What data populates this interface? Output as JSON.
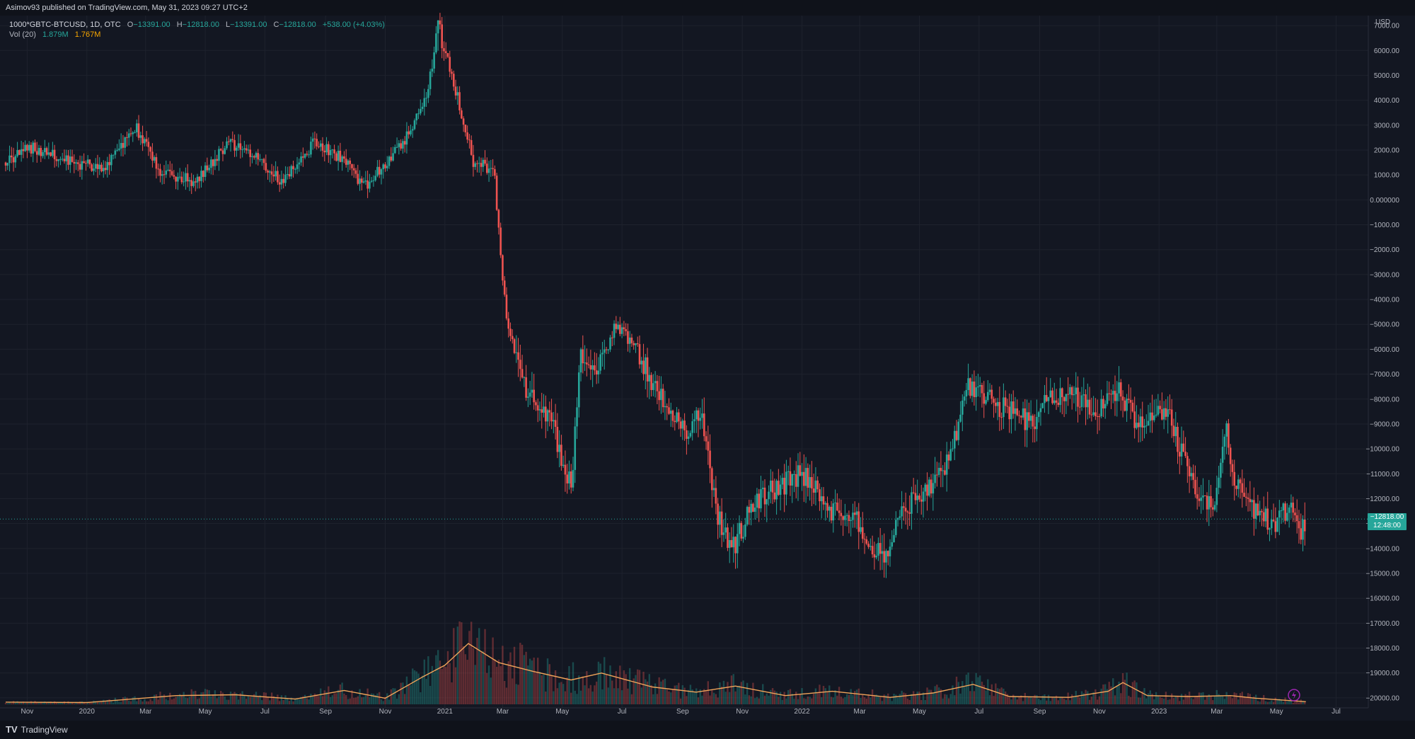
{
  "header": {
    "publisher_text": "Asimov93 published on TradingView.com, May 31, 2023 09:27 UTC+2"
  },
  "legend": {
    "symbol": "1000*GBTC-BTCUSD, 1D, OTC",
    "open_label": "O",
    "open_value": "−13391.00",
    "high_label": "H",
    "high_value": "−12818.00",
    "low_label": "L",
    "low_value": "−13391.00",
    "close_label": "C",
    "close_value": "−12818.00",
    "change_value": "+538.00 (+4.03%)",
    "vol_label": "Vol (20)",
    "vol_value": "1.879M",
    "vol_ma_value": "1.767M"
  },
  "axis": {
    "currency": "USD"
  },
  "price_tag": {
    "value": "−12818.00",
    "countdown": "12:48:00"
  },
  "brand": {
    "name": "TradingView",
    "logo_text": "TV"
  },
  "colors": {
    "background": "#131722",
    "up": "#26a69a",
    "down": "#ef5350",
    "vol_ma": "#f0a45a",
    "grid": "#1e222d",
    "axis_text": "#b2b5be"
  },
  "chart_data": {
    "type": "candlestick",
    "y_axis": {
      "unit": "USD",
      "range": [
        -20400,
        7400
      ],
      "ticks": [
        7000,
        6000,
        5000,
        4000,
        3000,
        2000,
        1000,
        0,
        -1000,
        -2000,
        -3000,
        -4000,
        -5000,
        -6000,
        -7000,
        -8000,
        -9000,
        -10000,
        -11000,
        -12000,
        -13000,
        -14000,
        -15000,
        -16000,
        -17000,
        -18000,
        -19000,
        -20000
      ],
      "tick_labels": [
        "7000.00",
        "6000.00",
        "5000.00",
        "4000.00",
        "3000.00",
        "2000.00",
        "1000.00",
        "0.000000",
        "−1000.00",
        "−2000.00",
        "−3000.00",
        "−4000.00",
        "−5000.00",
        "−6000.00",
        "−7000.00",
        "−8000.00",
        "−9000.00",
        "−10000.00",
        "−11000.00",
        "−12000.00",
        "−13000.00",
        "−14000.00",
        "−15000.00",
        "−16000.00",
        "−17000.00",
        "−18000.00",
        "−19000.00",
        "−20000.00"
      ]
    },
    "x_axis": {
      "range": [
        "2019-10-10",
        "2023-07-31"
      ],
      "ticks": [
        {
          "label": "Nov",
          "date": "2019-11-01"
        },
        {
          "label": "2020",
          "date": "2020-01-01"
        },
        {
          "label": "Mar",
          "date": "2020-03-01"
        },
        {
          "label": "May",
          "date": "2020-05-01"
        },
        {
          "label": "Jul",
          "date": "2020-07-01"
        },
        {
          "label": "Sep",
          "date": "2020-09-01"
        },
        {
          "label": "Nov",
          "date": "2020-11-01"
        },
        {
          "label": "2021",
          "date": "2021-01-01"
        },
        {
          "label": "Mar",
          "date": "2021-03-01"
        },
        {
          "label": "May",
          "date": "2021-05-01"
        },
        {
          "label": "Jul",
          "date": "2021-07-01"
        },
        {
          "label": "Sep",
          "date": "2021-09-01"
        },
        {
          "label": "Nov",
          "date": "2021-11-01"
        },
        {
          "label": "2022",
          "date": "2022-01-01"
        },
        {
          "label": "Mar",
          "date": "2022-03-01"
        },
        {
          "label": "May",
          "date": "2022-05-01"
        },
        {
          "label": "Jul",
          "date": "2022-07-01"
        },
        {
          "label": "Sep",
          "date": "2022-09-01"
        },
        {
          "label": "Nov",
          "date": "2022-11-01"
        },
        {
          "label": "2023",
          "date": "2023-01-01"
        },
        {
          "label": "Mar",
          "date": "2023-03-01"
        },
        {
          "label": "May",
          "date": "2023-05-01"
        },
        {
          "label": "Jul",
          "date": "2023-07-01"
        }
      ]
    },
    "price_path": [
      {
        "date": "2019-10-10",
        "value": 1500
      },
      {
        "date": "2019-11-05",
        "value": 2100
      },
      {
        "date": "2019-12-15",
        "value": 1500
      },
      {
        "date": "2020-01-20",
        "value": 1300
      },
      {
        "date": "2020-02-20",
        "value": 2900
      },
      {
        "date": "2020-03-15",
        "value": 1200
      },
      {
        "date": "2020-04-20",
        "value": 700
      },
      {
        "date": "2020-05-25",
        "value": 2300
      },
      {
        "date": "2020-06-20",
        "value": 1700
      },
      {
        "date": "2020-07-20",
        "value": 700
      },
      {
        "date": "2020-08-20",
        "value": 2300
      },
      {
        "date": "2020-09-20",
        "value": 1600
      },
      {
        "date": "2020-10-10",
        "value": 500
      },
      {
        "date": "2020-11-05",
        "value": 1700
      },
      {
        "date": "2020-11-25",
        "value": 2600
      },
      {
        "date": "2020-12-15",
        "value": 4500
      },
      {
        "date": "2020-12-25",
        "value": 7000
      },
      {
        "date": "2021-01-15",
        "value": 4000
      },
      {
        "date": "2021-01-30",
        "value": 1500
      },
      {
        "date": "2021-02-20",
        "value": 1200
      },
      {
        "date": "2021-03-05",
        "value": -5000
      },
      {
        "date": "2021-03-25",
        "value": -7500
      },
      {
        "date": "2021-04-20",
        "value": -9000
      },
      {
        "date": "2021-05-10",
        "value": -11500
      },
      {
        "date": "2021-05-20",
        "value": -6000
      },
      {
        "date": "2021-06-05",
        "value": -7000
      },
      {
        "date": "2021-06-25",
        "value": -5000
      },
      {
        "date": "2021-07-15",
        "value": -6000
      },
      {
        "date": "2021-08-10",
        "value": -8000
      },
      {
        "date": "2021-09-05",
        "value": -9500
      },
      {
        "date": "2021-09-20",
        "value": -8500
      },
      {
        "date": "2021-10-05",
        "value": -12500
      },
      {
        "date": "2021-10-22",
        "value": -14000
      },
      {
        "date": "2021-11-15",
        "value": -12000
      },
      {
        "date": "2021-12-10",
        "value": -11500
      },
      {
        "date": "2022-01-01",
        "value": -11000
      },
      {
        "date": "2022-02-01",
        "value": -12500
      },
      {
        "date": "2022-03-01",
        "value": -13000
      },
      {
        "date": "2022-03-25",
        "value": -14500
      },
      {
        "date": "2022-04-15",
        "value": -12500
      },
      {
        "date": "2022-05-10",
        "value": -11500
      },
      {
        "date": "2022-06-01",
        "value": -10500
      },
      {
        "date": "2022-06-20",
        "value": -7500
      },
      {
        "date": "2022-07-10",
        "value": -8000
      },
      {
        "date": "2022-08-01",
        "value": -8500
      },
      {
        "date": "2022-08-25",
        "value": -9000
      },
      {
        "date": "2022-09-10",
        "value": -7800
      },
      {
        "date": "2022-10-10",
        "value": -8000
      },
      {
        "date": "2022-11-01",
        "value": -8500
      },
      {
        "date": "2022-11-20",
        "value": -7500
      },
      {
        "date": "2022-12-10",
        "value": -9000
      },
      {
        "date": "2022-12-31",
        "value": -8500
      },
      {
        "date": "2023-01-10",
        "value": -8300
      },
      {
        "date": "2023-01-20",
        "value": -9800
      },
      {
        "date": "2023-02-05",
        "value": -11500
      },
      {
        "date": "2023-02-25",
        "value": -12500
      },
      {
        "date": "2023-03-10",
        "value": -9000
      },
      {
        "date": "2023-03-20",
        "value": -11500
      },
      {
        "date": "2023-04-10",
        "value": -12500
      },
      {
        "date": "2023-04-30",
        "value": -13000
      },
      {
        "date": "2023-05-15",
        "value": -12200
      },
      {
        "date": "2023-05-25",
        "value": -13300
      },
      {
        "date": "2023-05-31",
        "value": -12818
      }
    ],
    "volume_ma_path": [
      {
        "date": "2019-10-10",
        "value": 0.25
      },
      {
        "date": "2020-01-01",
        "value": 0.2
      },
      {
        "date": "2020-04-01",
        "value": 1.0
      },
      {
        "date": "2020-06-01",
        "value": 1.1
      },
      {
        "date": "2020-08-01",
        "value": 0.6
      },
      {
        "date": "2020-09-20",
        "value": 1.6
      },
      {
        "date": "2020-11-01",
        "value": 0.7
      },
      {
        "date": "2020-12-10",
        "value": 3.2
      },
      {
        "date": "2021-01-01",
        "value": 4.5
      },
      {
        "date": "2021-01-25",
        "value": 7.0
      },
      {
        "date": "2021-02-25",
        "value": 4.8
      },
      {
        "date": "2021-04-01",
        "value": 3.8
      },
      {
        "date": "2021-05-10",
        "value": 2.8
      },
      {
        "date": "2021-06-10",
        "value": 3.6
      },
      {
        "date": "2021-08-01",
        "value": 2.0
      },
      {
        "date": "2021-09-15",
        "value": 1.4
      },
      {
        "date": "2021-10-25",
        "value": 2.1
      },
      {
        "date": "2021-12-15",
        "value": 1.0
      },
      {
        "date": "2022-02-01",
        "value": 1.5
      },
      {
        "date": "2022-04-01",
        "value": 0.8
      },
      {
        "date": "2022-05-15",
        "value": 1.3
      },
      {
        "date": "2022-06-25",
        "value": 2.3
      },
      {
        "date": "2022-08-01",
        "value": 0.9
      },
      {
        "date": "2022-10-01",
        "value": 0.8
      },
      {
        "date": "2022-11-10",
        "value": 1.5
      },
      {
        "date": "2022-11-25",
        "value": 2.5
      },
      {
        "date": "2022-12-20",
        "value": 1.0
      },
      {
        "date": "2023-02-01",
        "value": 0.9
      },
      {
        "date": "2023-03-15",
        "value": 1.0
      },
      {
        "date": "2023-04-10",
        "value": 0.7
      },
      {
        "date": "2023-05-31",
        "value": 0.3
      }
    ],
    "last_price": -12818,
    "volume_scale_max": 11
  }
}
